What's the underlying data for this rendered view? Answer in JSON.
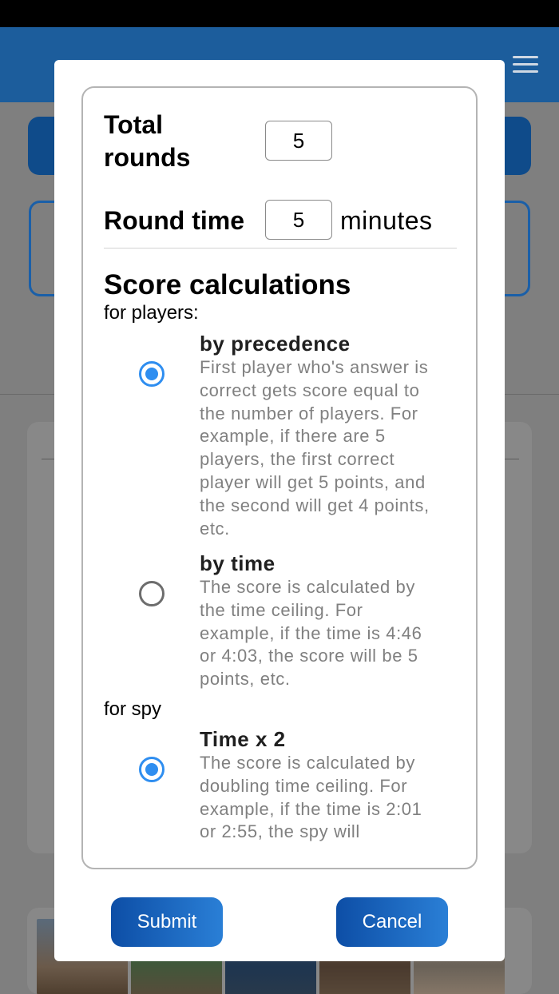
{
  "modal": {
    "total_rounds": {
      "label": "Total rounds",
      "value": "5"
    },
    "round_time": {
      "label": "Round time",
      "value": "5",
      "unit": "minutes"
    },
    "score_section": {
      "title": "Score calculations",
      "players_label": "for players:",
      "spy_label": "for spy",
      "player_options": [
        {
          "title": "by precedence",
          "selected": true,
          "description": "First player who's answer is correct gets score equal to the number of players. For example, if there are 5 players, the first correct player will get 5 points, and the second will get 4 points, etc."
        },
        {
          "title": "by time",
          "selected": false,
          "description": "The score is calculated by the time ceiling. For example, if the time is 4:46 or 4:03, the score will be 5 points, etc."
        }
      ],
      "spy_options": [
        {
          "title": "Time x 2",
          "selected": true,
          "description": "The score is calculated by doubling time ceiling. For example, if the time is 2:01 or 2:55, the spy will"
        }
      ]
    },
    "buttons": {
      "submit": "Submit",
      "cancel": "Cancel"
    }
  },
  "colors": {
    "accent": "#2f8ef0",
    "button_start": "#0d4ea6",
    "button_end": "#2a7fd6"
  },
  "icons": {
    "menu": "hamburger-menu-icon"
  }
}
